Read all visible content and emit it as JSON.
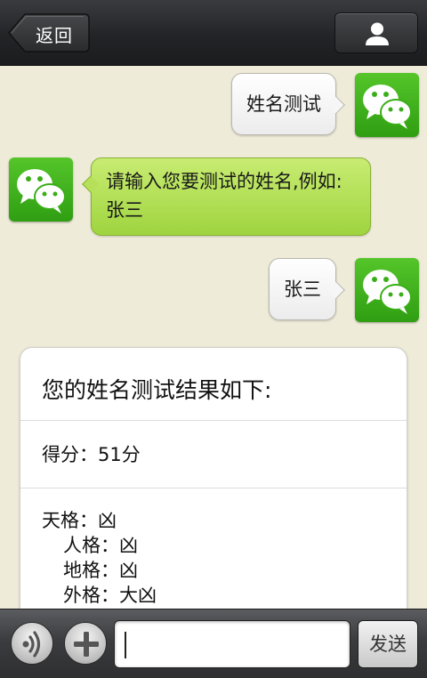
{
  "header": {
    "back_label": "返回"
  },
  "messages": [
    {
      "from": "me",
      "text": "姓名测试"
    },
    {
      "from": "bot",
      "text": "请输入您要测试的姓名,例如:张三"
    },
    {
      "from": "me",
      "text": "张三"
    }
  ],
  "result": {
    "title": "您的姓名测试结果如下:",
    "score": "得分：51分",
    "grids": [
      "天格：凶",
      "人格：凶",
      "地格：凶",
      "外格：大凶"
    ]
  },
  "input": {
    "value": ""
  },
  "footer": {
    "send_label": "发送"
  },
  "colors": {
    "chat_bg": "#efebd9",
    "avatar_green": "#3aae18",
    "bubble_green": "#b6e05a",
    "topbar": "#232427"
  },
  "icons": {
    "back": "back-arrow-icon",
    "profile": "person-icon",
    "avatar": "wechat-logo-icon",
    "voice": "voice-waves-icon",
    "add": "plus-icon"
  }
}
